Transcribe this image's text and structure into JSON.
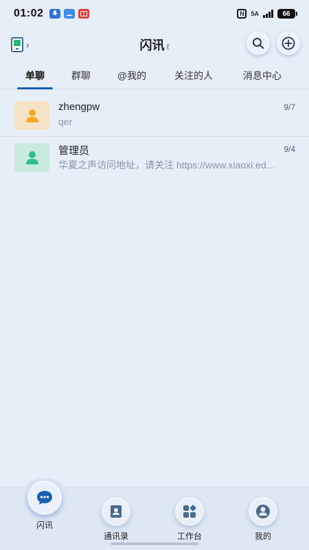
{
  "status_bar": {
    "time": "01:02",
    "network": "5A",
    "nfc": "N",
    "battery": "66"
  },
  "header": {
    "title": "闪讯",
    "title_mark": "ℓ"
  },
  "tabs": [
    {
      "label": "单聊",
      "active": true
    },
    {
      "label": "群聊",
      "active": false
    },
    {
      "label": "@我的",
      "active": false
    },
    {
      "label": "关注的人",
      "active": false
    },
    {
      "label": "消息中心",
      "active": false
    }
  ],
  "chats": [
    {
      "name": "zhengpw",
      "preview": "qer",
      "date": "9/7",
      "avatar_color": "#f5a623"
    },
    {
      "name": "管理员",
      "preview": "华夏之声访问地址，请关注 https://www.xiaoxi.edu.cn/voice",
      "date": "9/4",
      "avatar_color": "#2fbf8a"
    }
  ],
  "bottom_nav": [
    {
      "label": "闪讯",
      "icon": "chat-bubble-icon",
      "active": true
    },
    {
      "label": "通讯录",
      "icon": "contacts-icon",
      "active": false
    },
    {
      "label": "工作台",
      "icon": "workbench-icon",
      "active": false
    },
    {
      "label": "我的",
      "icon": "profile-icon",
      "active": false
    }
  ],
  "colors": {
    "accent": "#1a5fb4",
    "background": "#e6eef8"
  }
}
